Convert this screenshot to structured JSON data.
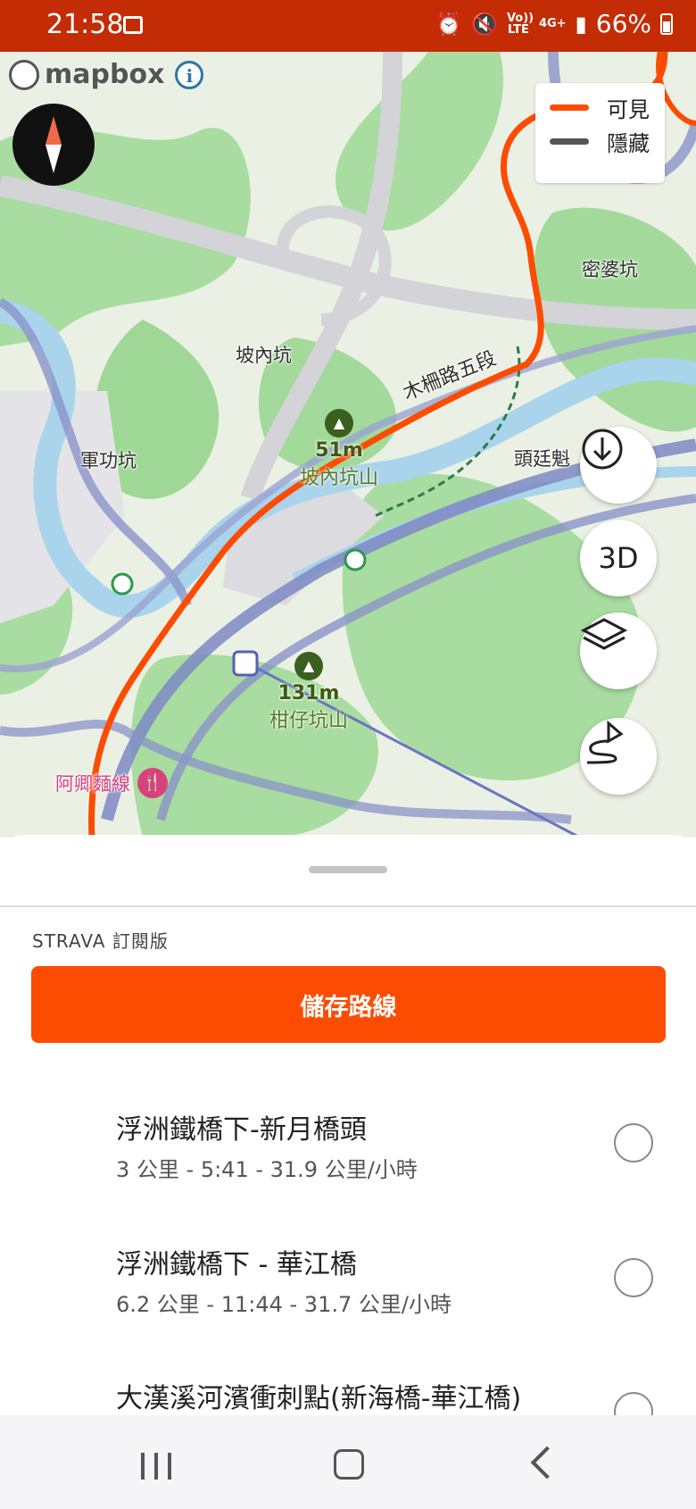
{
  "status_bar": {
    "time": "21:58",
    "volte": "Vo)) LTE",
    "network": "4G+",
    "battery": "66%",
    "icons": [
      "gallery-icon",
      "alarm-icon",
      "mute-icon",
      "signal-icon",
      "battery-icon"
    ]
  },
  "map": {
    "attribution": "mapbox",
    "legend": {
      "visible_label": "可見",
      "hidden_label": "隱藏",
      "visible_color": "#fc4c02",
      "hidden_color": "#555555"
    },
    "place_labels": [
      "密婆坑",
      "坡內坑",
      "軍功坑",
      "頭廷魁"
    ],
    "road_label": "木柵路五段",
    "peaks": [
      {
        "elevation": "51m",
        "name": "坡內坑山"
      },
      {
        "elevation": "131m",
        "name": "柑仔坑山"
      }
    ],
    "poi": {
      "name": "阿卿麵線",
      "icon": "restaurant-icon"
    },
    "buttons": {
      "three_d": "3D",
      "download_icon": "download-icon",
      "layers_icon": "layers-icon",
      "route_icon": "route-icon"
    }
  },
  "sheet": {
    "subscription_label": "STRAVA 訂閱版",
    "save_button": "儲存路線",
    "routes": [
      {
        "title": "浮洲鐵橋下-新月橋頭",
        "stats": "3 公里 - 5:41 - 31.9 公里/小時"
      },
      {
        "title": "浮洲鐵橋下 - 華江橋",
        "stats": "6.2 公里 - 11:44 - 31.7 公里/小時"
      },
      {
        "title": "大漢溪河濱衝刺點(新海橋-華江橋)",
        "stats": ""
      }
    ]
  },
  "colors": {
    "status_bar": "#c32c05",
    "accent": "#fc4c02",
    "route_line": "#fc4c02"
  }
}
